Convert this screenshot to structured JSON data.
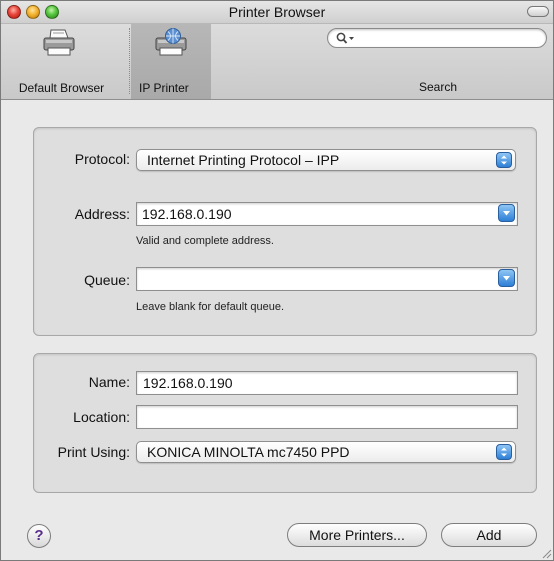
{
  "window": {
    "title": "Printer Browser"
  },
  "toolbar": {
    "items": [
      {
        "label": "Default Browser",
        "icon": "printer-icon"
      },
      {
        "label": "IP Printer",
        "icon": "ip-printer-icon",
        "selected": true
      }
    ],
    "search": {
      "label": "Search",
      "value": "",
      "placeholder": ""
    }
  },
  "connection": {
    "protocol": {
      "label": "Protocol:",
      "value": "Internet Printing Protocol – IPP"
    },
    "address": {
      "label": "Address:",
      "value": "192.168.0.190",
      "hint": "Valid and complete address."
    },
    "queue": {
      "label": "Queue:",
      "value": "",
      "hint": "Leave blank for default queue."
    }
  },
  "printer": {
    "name": {
      "label": "Name:",
      "value": "192.168.0.190"
    },
    "location": {
      "label": "Location:",
      "value": ""
    },
    "print_using": {
      "label": "Print Using:",
      "value": "KONICA MINOLTA mc7450 PPD"
    }
  },
  "footer": {
    "help": "?",
    "more_printers": "More Printers...",
    "add": "Add"
  },
  "colors": {
    "accent": "#2d7fd6",
    "help_glyph": "#5a2d8c"
  }
}
